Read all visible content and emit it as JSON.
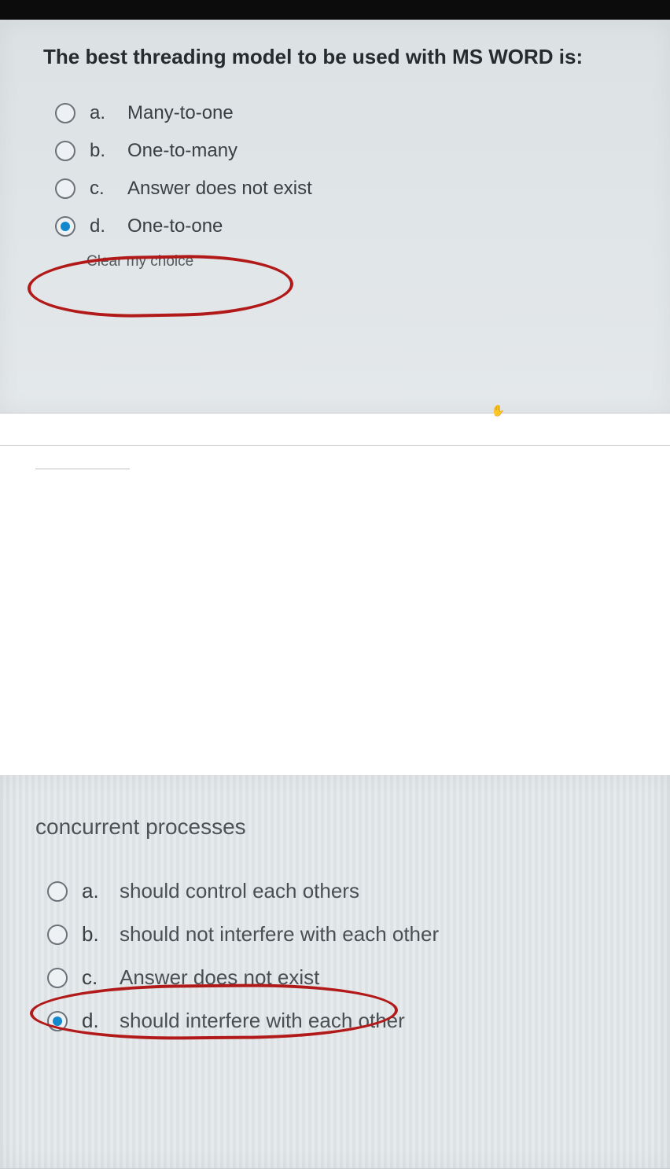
{
  "q1": {
    "title": "The best threading model to be used with MS WORD is:",
    "options": [
      {
        "letter": "a.",
        "text": "Many-to-one",
        "selected": false
      },
      {
        "letter": "b.",
        "text": "One-to-many",
        "selected": false
      },
      {
        "letter": "c.",
        "text": "Answer does not exist",
        "selected": false
      },
      {
        "letter": "d.",
        "text": "One-to-one",
        "selected": true
      }
    ],
    "clear_label": "Clear my choice",
    "circled_index": 3
  },
  "q2": {
    "title": "concurrent processes",
    "options": [
      {
        "letter": "a.",
        "text": "should control each others",
        "selected": false
      },
      {
        "letter": "b.",
        "text": "should not interfere with each other",
        "selected": false
      },
      {
        "letter": "c.",
        "text": "Answer does not exist",
        "selected": false
      },
      {
        "letter": "d.",
        "text": "should interfere with each other",
        "selected": true
      }
    ],
    "circled_index": 2
  }
}
